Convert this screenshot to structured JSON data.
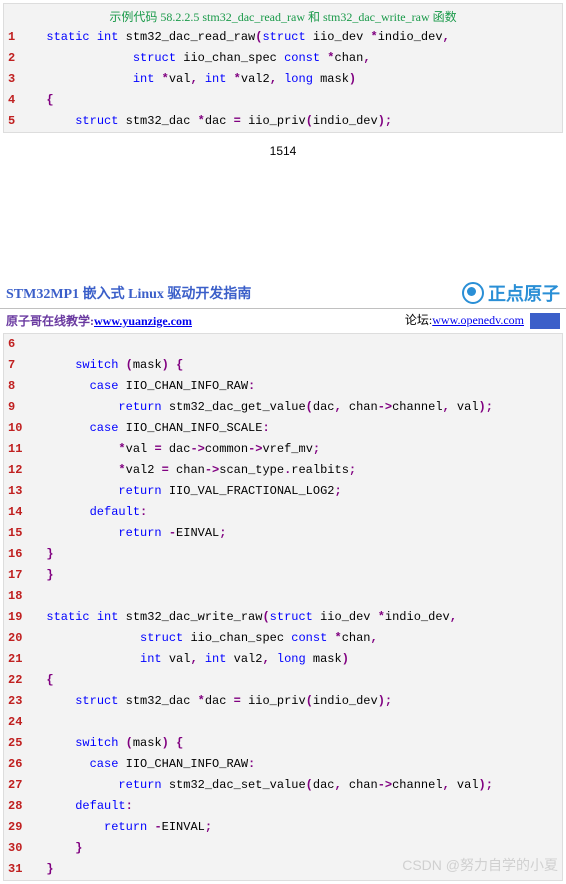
{
  "page1": {
    "code_title": "示例代码 58.2.2.5 stm32_dac_read_raw 和 stm32_dac_write_raw 函数",
    "page_number": "1514",
    "lines": [
      {
        "n": "1",
        "tokens": [
          {
            "c": "kw-static",
            "t": "static"
          },
          {
            "c": "plain",
            "t": " "
          },
          {
            "c": "kw-int",
            "t": "int"
          },
          {
            "c": "plain",
            "t": " stm32_dac_read_raw"
          },
          {
            "c": "op-purple",
            "t": "("
          },
          {
            "c": "kw-struct",
            "t": "struct"
          },
          {
            "c": "plain",
            "t": " iio_dev "
          },
          {
            "c": "op-purple",
            "t": "*"
          },
          {
            "c": "plain",
            "t": "indio_dev"
          },
          {
            "c": "op-purple",
            "t": ","
          }
        ],
        "indent": "  "
      },
      {
        "n": "2",
        "tokens": [
          {
            "c": "kw-struct",
            "t": "struct"
          },
          {
            "c": "plain",
            "t": " iio_chan_spec "
          },
          {
            "c": "kw-const",
            "t": "const"
          },
          {
            "c": "plain",
            "t": " "
          },
          {
            "c": "op-purple",
            "t": "*"
          },
          {
            "c": "plain",
            "t": "chan"
          },
          {
            "c": "op-purple",
            "t": ","
          }
        ],
        "indent": "              "
      },
      {
        "n": "3",
        "tokens": [
          {
            "c": "kw-int",
            "t": "int"
          },
          {
            "c": "plain",
            "t": " "
          },
          {
            "c": "op-purple",
            "t": "*"
          },
          {
            "c": "plain",
            "t": "val"
          },
          {
            "c": "op-purple",
            "t": ","
          },
          {
            "c": "plain",
            "t": " "
          },
          {
            "c": "kw-int",
            "t": "int"
          },
          {
            "c": "plain",
            "t": " "
          },
          {
            "c": "op-purple",
            "t": "*"
          },
          {
            "c": "plain",
            "t": "val2"
          },
          {
            "c": "op-purple",
            "t": ","
          },
          {
            "c": "plain",
            "t": " "
          },
          {
            "c": "kw-long",
            "t": "long"
          },
          {
            "c": "plain",
            "t": " mask"
          },
          {
            "c": "op-purple",
            "t": ")"
          }
        ],
        "indent": "              "
      },
      {
        "n": "4",
        "tokens": [
          {
            "c": "op-purple",
            "t": "{"
          }
        ],
        "indent": "  "
      },
      {
        "n": "5",
        "tokens": [
          {
            "c": "kw-struct",
            "t": "struct"
          },
          {
            "c": "plain",
            "t": " stm32_dac "
          },
          {
            "c": "op-purple",
            "t": "*"
          },
          {
            "c": "plain",
            "t": "dac "
          },
          {
            "c": "op-purple",
            "t": "="
          },
          {
            "c": "plain",
            "t": " iio_priv"
          },
          {
            "c": "op-purple",
            "t": "("
          },
          {
            "c": "plain",
            "t": "indio_dev"
          },
          {
            "c": "op-purple",
            "t": ");"
          }
        ],
        "indent": "      "
      }
    ]
  },
  "page2": {
    "header_title": "STM32MP1 嵌入式 Linux 驱动开发指南",
    "brand_text": "正点原子",
    "sub_left_prefix": "原子哥在线教学:",
    "sub_left_link": "www.yuanzige.com",
    "sub_right_prefix": "论坛:",
    "sub_right_link": "www.openedv.com",
    "watermark": "CSDN @努力自学的小夏",
    "lines": [
      {
        "n": "6",
        "tokens": [],
        "indent": ""
      },
      {
        "n": "7",
        "tokens": [
          {
            "c": "kw-switch",
            "t": "switch"
          },
          {
            "c": "plain",
            "t": " "
          },
          {
            "c": "op-purple",
            "t": "("
          },
          {
            "c": "plain",
            "t": "mask"
          },
          {
            "c": "op-purple",
            "t": ")"
          },
          {
            "c": "plain",
            "t": " "
          },
          {
            "c": "op-purple",
            "t": "{"
          }
        ],
        "indent": "      "
      },
      {
        "n": "8",
        "tokens": [
          {
            "c": "kw-case",
            "t": "case"
          },
          {
            "c": "plain",
            "t": " IIO_CHAN_INFO_RAW"
          },
          {
            "c": "op-purple",
            "t": ":"
          }
        ],
        "indent": "        "
      },
      {
        "n": "9",
        "tokens": [
          {
            "c": "kw-return",
            "t": "return"
          },
          {
            "c": "plain",
            "t": " stm32_dac_get_value"
          },
          {
            "c": "op-purple",
            "t": "("
          },
          {
            "c": "plain",
            "t": "dac"
          },
          {
            "c": "op-purple",
            "t": ","
          },
          {
            "c": "plain",
            "t": " chan"
          },
          {
            "c": "op-purple",
            "t": "->"
          },
          {
            "c": "plain",
            "t": "channel"
          },
          {
            "c": "op-purple",
            "t": ","
          },
          {
            "c": "plain",
            "t": " val"
          },
          {
            "c": "op-purple",
            "t": ");"
          }
        ],
        "indent": "            "
      },
      {
        "n": "10",
        "tokens": [
          {
            "c": "kw-case",
            "t": "case"
          },
          {
            "c": "plain",
            "t": " IIO_CHAN_INFO_SCALE"
          },
          {
            "c": "op-purple",
            "t": ":"
          }
        ],
        "indent": "        "
      },
      {
        "n": "11",
        "tokens": [
          {
            "c": "op-purple",
            "t": "*"
          },
          {
            "c": "plain",
            "t": "val "
          },
          {
            "c": "op-purple",
            "t": "="
          },
          {
            "c": "plain",
            "t": " dac"
          },
          {
            "c": "op-purple",
            "t": "->"
          },
          {
            "c": "plain",
            "t": "common"
          },
          {
            "c": "op-purple",
            "t": "->"
          },
          {
            "c": "plain",
            "t": "vref_mv"
          },
          {
            "c": "op-purple",
            "t": ";"
          }
        ],
        "indent": "            "
      },
      {
        "n": "12",
        "tokens": [
          {
            "c": "op-purple",
            "t": "*"
          },
          {
            "c": "plain",
            "t": "val2 "
          },
          {
            "c": "op-purple",
            "t": "="
          },
          {
            "c": "plain",
            "t": " chan"
          },
          {
            "c": "op-purple",
            "t": "->"
          },
          {
            "c": "plain",
            "t": "scan_type"
          },
          {
            "c": "op-purple",
            "t": "."
          },
          {
            "c": "plain",
            "t": "realbits"
          },
          {
            "c": "op-purple",
            "t": ";"
          }
        ],
        "indent": "            "
      },
      {
        "n": "13",
        "tokens": [
          {
            "c": "kw-return",
            "t": "return"
          },
          {
            "c": "plain",
            "t": " IIO_VAL_FRACTIONAL_LOG2"
          },
          {
            "c": "op-purple",
            "t": ";"
          }
        ],
        "indent": "            "
      },
      {
        "n": "14",
        "tokens": [
          {
            "c": "kw-default",
            "t": "default"
          },
          {
            "c": "op-purple",
            "t": ":"
          }
        ],
        "indent": "        "
      },
      {
        "n": "15",
        "tokens": [
          {
            "c": "kw-return",
            "t": "return"
          },
          {
            "c": "plain",
            "t": " "
          },
          {
            "c": "op-purple",
            "t": "-"
          },
          {
            "c": "plain",
            "t": "EINVAL"
          },
          {
            "c": "op-purple",
            "t": ";"
          }
        ],
        "indent": "            "
      },
      {
        "n": "16",
        "tokens": [
          {
            "c": "op-purple",
            "t": "}"
          }
        ],
        "indent": "  "
      },
      {
        "n": "17",
        "tokens": [
          {
            "c": "op-purple",
            "t": "}"
          }
        ],
        "indent": "  "
      },
      {
        "n": "18",
        "tokens": [],
        "indent": ""
      },
      {
        "n": "19",
        "tokens": [
          {
            "c": "kw-static",
            "t": "static"
          },
          {
            "c": "plain",
            "t": " "
          },
          {
            "c": "kw-int",
            "t": "int"
          },
          {
            "c": "plain",
            "t": " stm32_dac_write_raw"
          },
          {
            "c": "op-purple",
            "t": "("
          },
          {
            "c": "kw-struct",
            "t": "struct"
          },
          {
            "c": "plain",
            "t": " iio_dev "
          },
          {
            "c": "op-purple",
            "t": "*"
          },
          {
            "c": "plain",
            "t": "indio_dev"
          },
          {
            "c": "op-purple",
            "t": ","
          }
        ],
        "indent": "  "
      },
      {
        "n": "20",
        "tokens": [
          {
            "c": "kw-struct",
            "t": "struct"
          },
          {
            "c": "plain",
            "t": " iio_chan_spec "
          },
          {
            "c": "kw-const",
            "t": "const"
          },
          {
            "c": "plain",
            "t": " "
          },
          {
            "c": "op-purple",
            "t": "*"
          },
          {
            "c": "plain",
            "t": "chan"
          },
          {
            "c": "op-purple",
            "t": ","
          }
        ],
        "indent": "               "
      },
      {
        "n": "21",
        "tokens": [
          {
            "c": "kw-int",
            "t": "int"
          },
          {
            "c": "plain",
            "t": " val"
          },
          {
            "c": "op-purple",
            "t": ","
          },
          {
            "c": "plain",
            "t": " "
          },
          {
            "c": "kw-int",
            "t": "int"
          },
          {
            "c": "plain",
            "t": " val2"
          },
          {
            "c": "op-purple",
            "t": ","
          },
          {
            "c": "plain",
            "t": " "
          },
          {
            "c": "kw-long",
            "t": "long"
          },
          {
            "c": "plain",
            "t": " mask"
          },
          {
            "c": "op-purple",
            "t": ")"
          }
        ],
        "indent": "               "
      },
      {
        "n": "22",
        "tokens": [
          {
            "c": "op-purple",
            "t": "{"
          }
        ],
        "indent": "  "
      },
      {
        "n": "23",
        "tokens": [
          {
            "c": "kw-struct",
            "t": "struct"
          },
          {
            "c": "plain",
            "t": " stm32_dac "
          },
          {
            "c": "op-purple",
            "t": "*"
          },
          {
            "c": "plain",
            "t": "dac "
          },
          {
            "c": "op-purple",
            "t": "="
          },
          {
            "c": "plain",
            "t": " iio_priv"
          },
          {
            "c": "op-purple",
            "t": "("
          },
          {
            "c": "plain",
            "t": "indio_dev"
          },
          {
            "c": "op-purple",
            "t": ");"
          }
        ],
        "indent": "      "
      },
      {
        "n": "24",
        "tokens": [],
        "indent": ""
      },
      {
        "n": "25",
        "tokens": [
          {
            "c": "kw-switch",
            "t": "switch"
          },
          {
            "c": "plain",
            "t": " "
          },
          {
            "c": "op-purple",
            "t": "("
          },
          {
            "c": "plain",
            "t": "mask"
          },
          {
            "c": "op-purple",
            "t": ")"
          },
          {
            "c": "plain",
            "t": " "
          },
          {
            "c": "op-purple",
            "t": "{"
          }
        ],
        "indent": "      "
      },
      {
        "n": "26",
        "tokens": [
          {
            "c": "kw-case",
            "t": "case"
          },
          {
            "c": "plain",
            "t": " IIO_CHAN_INFO_RAW"
          },
          {
            "c": "op-purple",
            "t": ":"
          }
        ],
        "indent": "        "
      },
      {
        "n": "27",
        "tokens": [
          {
            "c": "kw-return",
            "t": "return"
          },
          {
            "c": "plain",
            "t": " stm32_dac_set_value"
          },
          {
            "c": "op-purple",
            "t": "("
          },
          {
            "c": "plain",
            "t": "dac"
          },
          {
            "c": "op-purple",
            "t": ","
          },
          {
            "c": "plain",
            "t": " chan"
          },
          {
            "c": "op-purple",
            "t": "->"
          },
          {
            "c": "plain",
            "t": "channel"
          },
          {
            "c": "op-purple",
            "t": ","
          },
          {
            "c": "plain",
            "t": " val"
          },
          {
            "c": "op-purple",
            "t": ");"
          }
        ],
        "indent": "            "
      },
      {
        "n": "28",
        "tokens": [
          {
            "c": "kw-default",
            "t": "default"
          },
          {
            "c": "op-purple",
            "t": ":"
          }
        ],
        "indent": "      "
      },
      {
        "n": "29",
        "tokens": [
          {
            "c": "kw-return",
            "t": "return"
          },
          {
            "c": "plain",
            "t": " "
          },
          {
            "c": "op-purple",
            "t": "-"
          },
          {
            "c": "plain",
            "t": "EINVAL"
          },
          {
            "c": "op-purple",
            "t": ";"
          }
        ],
        "indent": "          "
      },
      {
        "n": "30",
        "tokens": [
          {
            "c": "op-purple",
            "t": "}"
          }
        ],
        "indent": "      "
      },
      {
        "n": "31",
        "tokens": [
          {
            "c": "op-purple",
            "t": "}"
          }
        ],
        "indent": "  "
      }
    ]
  }
}
